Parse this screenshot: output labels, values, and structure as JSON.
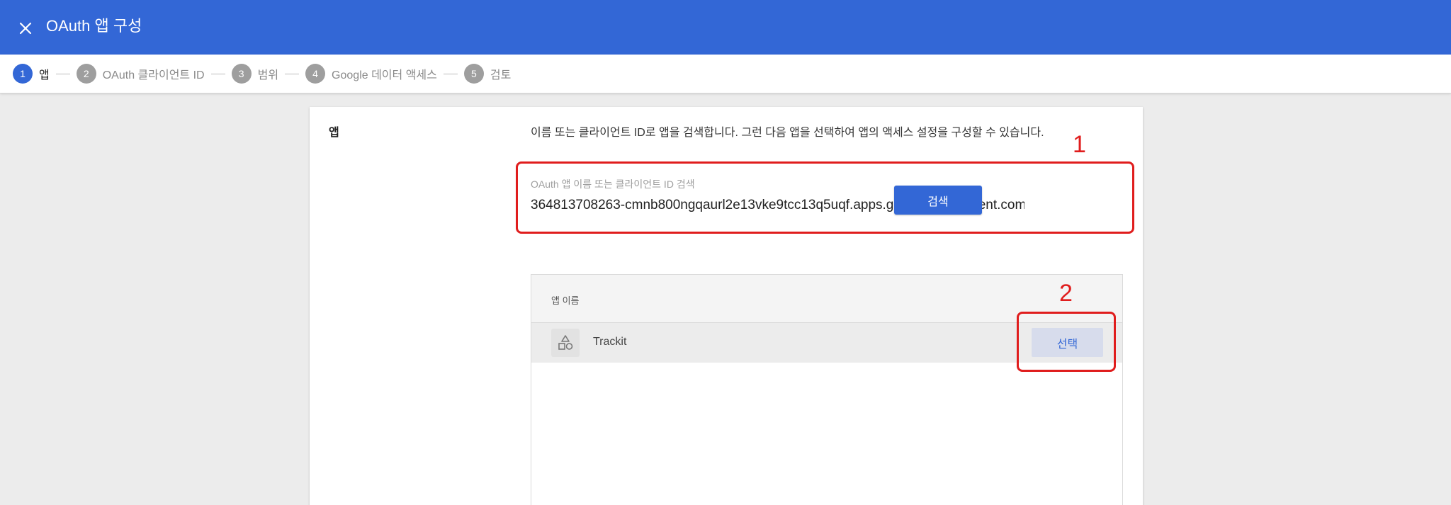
{
  "topbar": {
    "title": "OAuth 앱 구성",
    "close_icon": "close-icon",
    "background": "#3367d6"
  },
  "stepper": {
    "steps": [
      {
        "num": "1",
        "label": "앱",
        "active": true
      },
      {
        "num": "2",
        "label": "OAuth 클라이언트 ID",
        "active": false
      },
      {
        "num": "3",
        "label": "범위",
        "active": false
      },
      {
        "num": "4",
        "label": "Google 데이터 액세스",
        "active": false
      },
      {
        "num": "5",
        "label": "검토",
        "active": false
      }
    ]
  },
  "section": {
    "label": "앱",
    "description": "이름 또는 클라이언트 ID로 앱을 검색합니다. 그런 다음 앱을 선택하여 앱의 액세스 설정을 구성할 수 있습니다."
  },
  "search": {
    "label": "OAuth 앱 이름 또는 클라이언트 ID 검색",
    "value": "364813708263-cmnb800ngqaurl2e13vke9tcc13q5uqf.apps.googleusercontent.com",
    "button_label": "검색"
  },
  "results": {
    "column_header": "앱 이름",
    "rows": [
      {
        "name": "Trackit",
        "icon": "shapes-icon",
        "select_label": "선택"
      }
    ]
  },
  "annotations": [
    {
      "label": "1",
      "color": "#e01d1d"
    },
    {
      "label": "2",
      "color": "#e01d1d"
    }
  ]
}
